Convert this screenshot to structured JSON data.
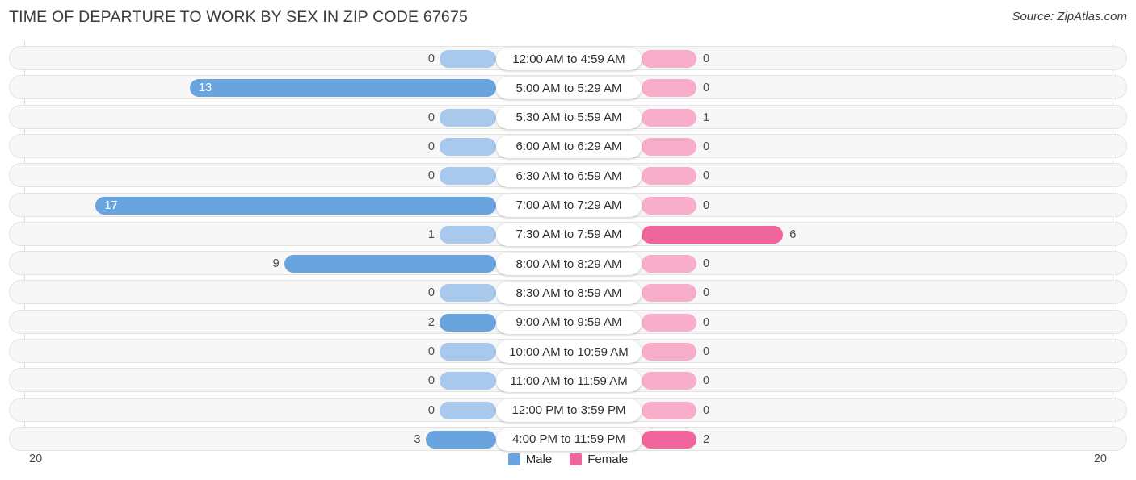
{
  "header": {
    "title": "TIME OF DEPARTURE TO WORK BY SEX IN ZIP CODE 67675",
    "source": "Source: ZipAtlas.com"
  },
  "legend": {
    "items": [
      {
        "label": "Male",
        "color": "#6aa4de"
      },
      {
        "label": "Female",
        "color": "#f0659b"
      }
    ]
  },
  "axis": {
    "left_tick": "20",
    "right_tick": "20"
  },
  "chart_data": {
    "type": "bar",
    "title": "TIME OF DEPARTURE TO WORK BY SEX IN ZIP CODE 67675",
    "subtitle": "Source: ZipAtlas.com",
    "orientation": "horizontal-diverging",
    "xlabel": "",
    "ylabel": "",
    "xlim": [
      20,
      20
    ],
    "grid": false,
    "legend_position": "bottom-center",
    "categories": [
      "12:00 AM to 4:59 AM",
      "5:00 AM to 5:29 AM",
      "5:30 AM to 5:59 AM",
      "6:00 AM to 6:29 AM",
      "6:30 AM to 6:59 AM",
      "7:00 AM to 7:29 AM",
      "7:30 AM to 7:59 AM",
      "8:00 AM to 8:29 AM",
      "8:30 AM to 8:59 AM",
      "9:00 AM to 9:59 AM",
      "10:00 AM to 10:59 AM",
      "11:00 AM to 11:59 AM",
      "12:00 PM to 3:59 PM",
      "4:00 PM to 11:59 PM"
    ],
    "series": [
      {
        "name": "Male",
        "color": "#6aa4de",
        "values": [
          0,
          13,
          0,
          0,
          0,
          17,
          1,
          9,
          0,
          2,
          0,
          0,
          0,
          3
        ]
      },
      {
        "name": "Female",
        "color": "#f0659b",
        "values": [
          0,
          0,
          1,
          0,
          0,
          0,
          6,
          0,
          0,
          0,
          0,
          0,
          0,
          2
        ]
      }
    ]
  },
  "rows": [
    {
      "category": "12:00 AM to 4:59 AM",
      "male": "0",
      "female": "0"
    },
    {
      "category": "5:00 AM to 5:29 AM",
      "male": "13",
      "female": "0"
    },
    {
      "category": "5:30 AM to 5:59 AM",
      "male": "0",
      "female": "1"
    },
    {
      "category": "6:00 AM to 6:29 AM",
      "male": "0",
      "female": "0"
    },
    {
      "category": "6:30 AM to 6:59 AM",
      "male": "0",
      "female": "0"
    },
    {
      "category": "7:00 AM to 7:29 AM",
      "male": "17",
      "female": "0"
    },
    {
      "category": "7:30 AM to 7:59 AM",
      "male": "1",
      "female": "6"
    },
    {
      "category": "8:00 AM to 8:29 AM",
      "male": "9",
      "female": "0"
    },
    {
      "category": "8:30 AM to 8:59 AM",
      "male": "0",
      "female": "0"
    },
    {
      "category": "9:00 AM to 9:59 AM",
      "male": "2",
      "female": "0"
    },
    {
      "category": "10:00 AM to 10:59 AM",
      "male": "0",
      "female": "0"
    },
    {
      "category": "11:00 AM to 11:59 AM",
      "male": "0",
      "female": "0"
    },
    {
      "category": "12:00 PM to 3:59 PM",
      "male": "0",
      "female": "0"
    },
    {
      "category": "4:00 PM to 11:59 PM",
      "male": "3",
      "female": "2"
    }
  ]
}
